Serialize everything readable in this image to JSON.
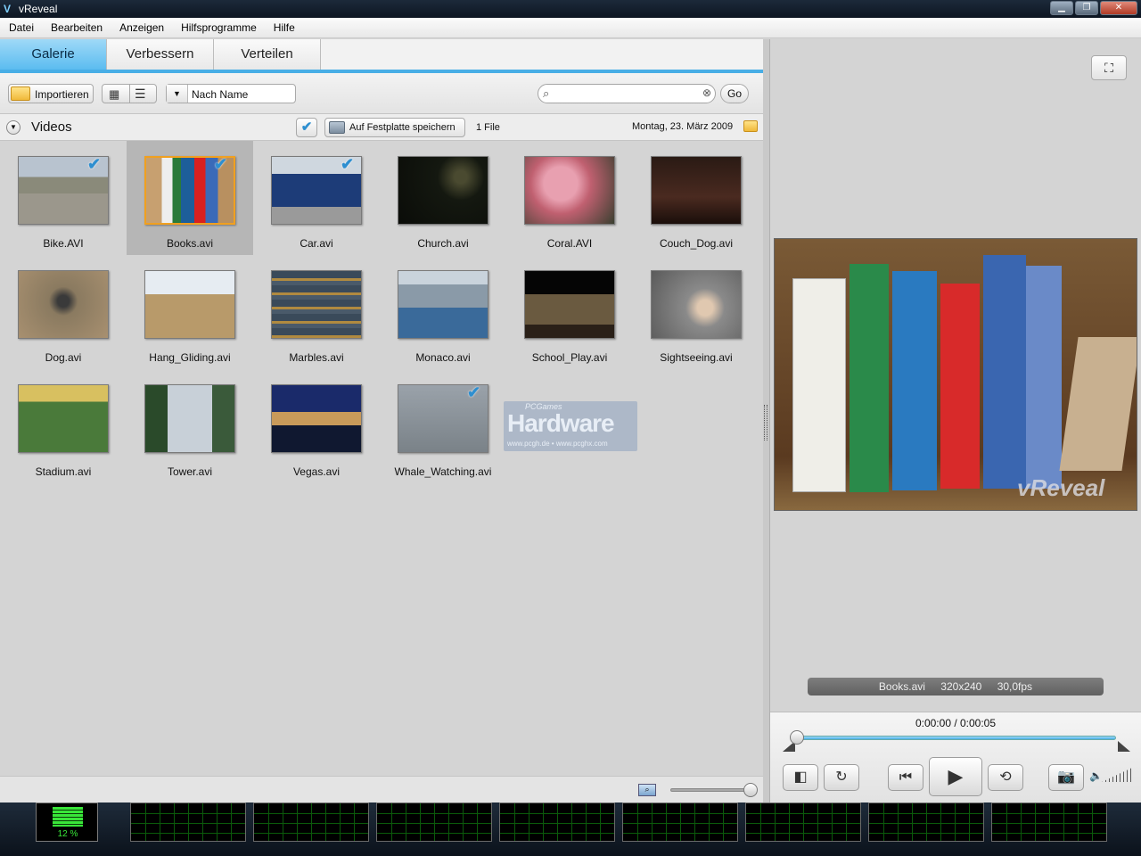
{
  "window": {
    "title": "vReveal"
  },
  "menu": [
    "Datei",
    "Bearbeiten",
    "Anzeigen",
    "Hilfsprogramme",
    "Hilfe"
  ],
  "tabs": [
    "Galerie",
    "Verbessern",
    "Verteilen"
  ],
  "toolbar": {
    "import_label": "Importieren",
    "sort_value": "Nach Name",
    "search_placeholder": "",
    "go_label": "Go"
  },
  "section": {
    "title": "Videos",
    "save_label": "Auf Festplatte speichern",
    "file_count": "1 File",
    "date": "Montag, 23. März 2009"
  },
  "videos": [
    {
      "name": "Bike.AVI",
      "checked": true,
      "selected": false
    },
    {
      "name": "Books.avi",
      "checked": true,
      "selected": true
    },
    {
      "name": "Car.avi",
      "checked": true,
      "selected": false
    },
    {
      "name": "Church.avi",
      "checked": false,
      "selected": false
    },
    {
      "name": "Coral.AVI",
      "checked": false,
      "selected": false
    },
    {
      "name": "Couch_Dog.avi",
      "checked": false,
      "selected": false
    },
    {
      "name": "Dog.avi",
      "checked": false,
      "selected": false
    },
    {
      "name": "Hang_Gliding.avi",
      "checked": false,
      "selected": false
    },
    {
      "name": "Marbles.avi",
      "checked": false,
      "selected": false
    },
    {
      "name": "Monaco.avi",
      "checked": false,
      "selected": false
    },
    {
      "name": "School_Play.avi",
      "checked": false,
      "selected": false
    },
    {
      "name": "Sightseeing.avi",
      "checked": false,
      "selected": false
    },
    {
      "name": "Stadium.avi",
      "checked": false,
      "selected": false
    },
    {
      "name": "Tower.avi",
      "checked": false,
      "selected": false
    },
    {
      "name": "Vegas.avi",
      "checked": false,
      "selected": false
    },
    {
      "name": "Whale_Watching.avi",
      "checked": true,
      "selected": false
    }
  ],
  "watermark": {
    "top": "PCGames",
    "main": "Hardware",
    "sub": "www.pcgh.de • www.pcghx.com"
  },
  "preview": {
    "filename": "Books.avi",
    "resolution": "320x240",
    "fps": "30,0fps",
    "logo": "vReveal",
    "time": "0:00:00 / 0:00:05",
    "progress": 0
  },
  "zoom": {
    "level": 1.0
  },
  "cpu": {
    "percent": "12 %"
  },
  "colors": {
    "accent": "#48aee6",
    "tab_active": "#5bbcf0",
    "selection": "#f0a020",
    "cpu_green": "#39e639"
  }
}
